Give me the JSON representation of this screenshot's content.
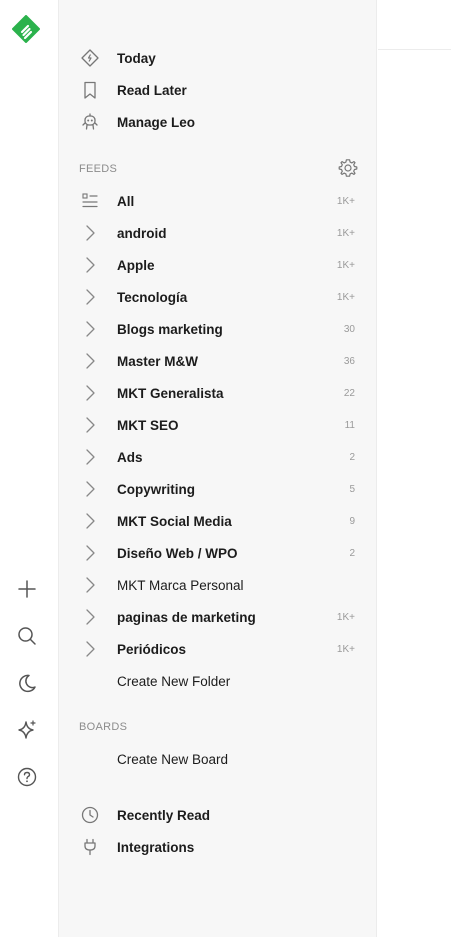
{
  "app": {
    "brand_color": "#2bb24c"
  },
  "rail": {
    "items": [
      {
        "name": "add-icon"
      },
      {
        "name": "search-icon"
      },
      {
        "name": "moon-icon"
      },
      {
        "name": "sparkle-icon"
      },
      {
        "name": "help-icon"
      }
    ]
  },
  "nav": {
    "today": "Today",
    "read_later": "Read Later",
    "manage_leo": "Manage Leo"
  },
  "feeds": {
    "section_label": "FEEDS",
    "items": [
      {
        "label": "All",
        "count": "1K+",
        "bold": true
      },
      {
        "label": "android",
        "count": "1K+",
        "bold": true
      },
      {
        "label": "Apple",
        "count": "1K+",
        "bold": true
      },
      {
        "label": "Tecnología",
        "count": "1K+",
        "bold": true
      },
      {
        "label": "Blogs marketing",
        "count": "30",
        "bold": true
      },
      {
        "label": "Master M&W",
        "count": "36",
        "bold": true
      },
      {
        "label": "MKT Generalista",
        "count": "22",
        "bold": true
      },
      {
        "label": "MKT SEO",
        "count": "11",
        "bold": true
      },
      {
        "label": "Ads",
        "count": "2",
        "bold": true
      },
      {
        "label": "Copywriting",
        "count": "5",
        "bold": true
      },
      {
        "label": "MKT Social Media",
        "count": "9",
        "bold": true
      },
      {
        "label": "Diseño Web / WPO",
        "count": "2",
        "bold": true
      },
      {
        "label": "MKT Marca Personal",
        "count": "",
        "bold": false
      },
      {
        "label": "paginas de marketing",
        "count": "1K+",
        "bold": true
      },
      {
        "label": "Periódicos",
        "count": "1K+",
        "bold": true
      }
    ],
    "create_folder": "Create New Folder"
  },
  "boards": {
    "section_label": "BOARDS",
    "create_board": "Create New Board"
  },
  "footer": {
    "recently_read": "Recently Read",
    "integrations": "Integrations"
  }
}
